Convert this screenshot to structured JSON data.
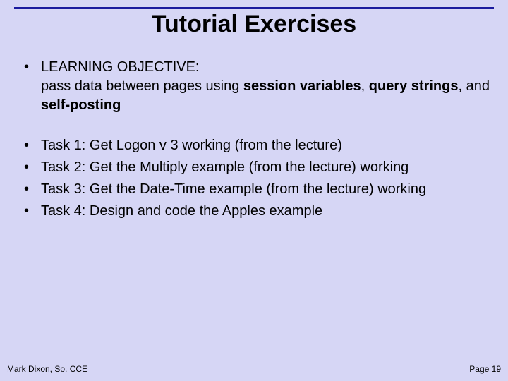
{
  "title": "Tutorial Exercises",
  "objective": {
    "label": "LEARNING OBJECTIVE:",
    "text_a": "pass data between pages using ",
    "b1": "session variables",
    "sep1": ", ",
    "b2": "query strings",
    "sep2": ", and ",
    "b3": "self-posting"
  },
  "tasks": {
    "t1": "Task 1: Get Logon v 3 working (from the lecture)",
    "t2": "Task 2: Get the Multiply example (from the lecture) working",
    "t3": "Task 3: Get the Date-Time example (from the lecture) working",
    "t4": "Task 4: Design and code the Apples example"
  },
  "footer": {
    "left": "Mark Dixon, So. CCE",
    "right": "Page 19"
  }
}
